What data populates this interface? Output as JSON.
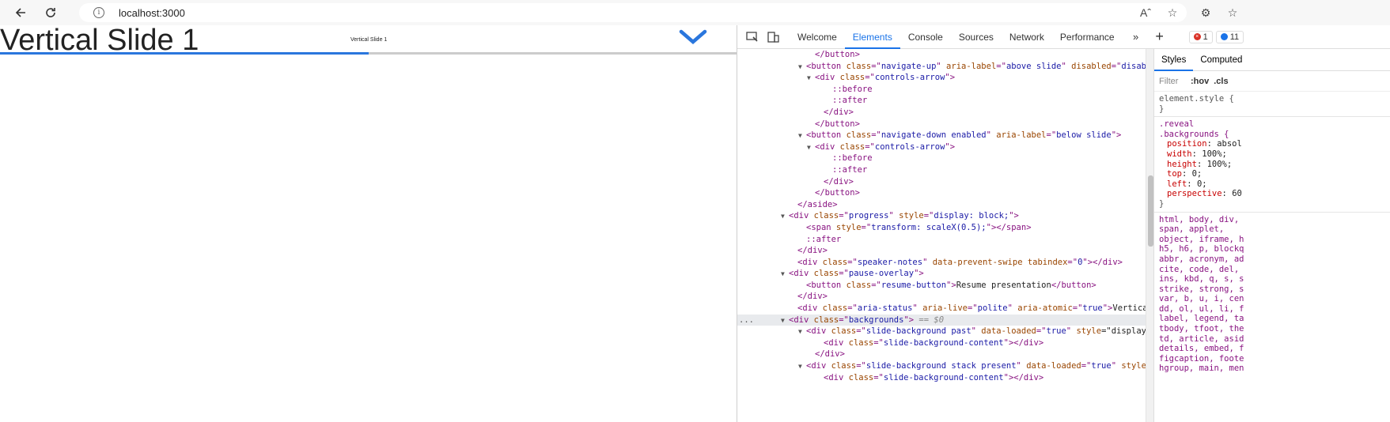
{
  "browser": {
    "url": "localhost:3000"
  },
  "page": {
    "slide_title": "Vertical Slide 1",
    "small_label": "Vertical Slide 1",
    "progress": 0.5
  },
  "devtools": {
    "tabs": [
      "Welcome",
      "Elements",
      "Console",
      "Sources",
      "Network",
      "Performance"
    ],
    "active_tab": "Elements",
    "error_count": "1",
    "message_count": "11",
    "styles_tabs": [
      "Styles",
      "Computed"
    ],
    "filter_placeholder": "Filter",
    "hov": ":hov",
    "cls": ".cls",
    "dom_lines": [
      {
        "indent": 8,
        "tri": "",
        "html": "</button>"
      },
      {
        "indent": 7,
        "tri": "▼",
        "html": "<button class=\"navigate-up\" aria-label=\"above slide\" disabled=\"disabled\">"
      },
      {
        "indent": 8,
        "tri": "▼",
        "html": "<div class=\"controls-arrow\">"
      },
      {
        "indent": 10,
        "tri": "",
        "html": "::before"
      },
      {
        "indent": 10,
        "tri": "",
        "html": "::after"
      },
      {
        "indent": 9,
        "tri": "",
        "html": "</div>"
      },
      {
        "indent": 8,
        "tri": "",
        "html": "</button>"
      },
      {
        "indent": 7,
        "tri": "▼",
        "html": "<button class=\"navigate-down enabled\" aria-label=\"below slide\">"
      },
      {
        "indent": 8,
        "tri": "▼",
        "html": "<div class=\"controls-arrow\">"
      },
      {
        "indent": 10,
        "tri": "",
        "html": "::before"
      },
      {
        "indent": 10,
        "tri": "",
        "html": "::after"
      },
      {
        "indent": 9,
        "tri": "",
        "html": "</div>"
      },
      {
        "indent": 8,
        "tri": "",
        "html": "</button>"
      },
      {
        "indent": 6,
        "tri": "",
        "html": "</aside>"
      },
      {
        "indent": 5,
        "tri": "▼",
        "html": "<div class=\"progress\" style=\"display: block;\">"
      },
      {
        "indent": 7,
        "tri": "",
        "html": "<span style=\"transform: scaleX(0.5);\"></span>"
      },
      {
        "indent": 7,
        "tri": "",
        "html": "::after"
      },
      {
        "indent": 6,
        "tri": "",
        "html": "</div>"
      },
      {
        "indent": 6,
        "tri": "",
        "html": "<div class=\"speaker-notes\" data-prevent-swipe tabindex=\"0\"></div>"
      },
      {
        "indent": 5,
        "tri": "▼",
        "html": "<div class=\"pause-overlay\">"
      },
      {
        "indent": 7,
        "tri": "",
        "html": "<button class=\"resume-button\">Resume presentation</button>"
      },
      {
        "indent": 6,
        "tri": "",
        "html": "</div>"
      },
      {
        "indent": 6,
        "tri": "",
        "html": "<div class=\"aria-status\" aria-live=\"polite\" aria-atomic=\"true\">Vertical Slid"
      },
      {
        "indent": 5,
        "tri": "▼",
        "html": "<div class=\"backgrounds\"> == $0",
        "selected": true
      },
      {
        "indent": 7,
        "tri": "▼",
        "html": "<div class=\"slide-background past\" data-loaded=\"true\" style=\"display: blo"
      },
      {
        "indent": 9,
        "tri": "",
        "html": "<div class=\"slide-background-content\"></div>"
      },
      {
        "indent": 8,
        "tri": "",
        "html": "</div>"
      },
      {
        "indent": 7,
        "tri": "▼",
        "html": "<div class=\"slide-background stack present\" data-loaded=\"true\" style=\"dis"
      },
      {
        "indent": 9,
        "tri": "",
        "html": "<div class=\"slide-background-content\"></div>"
      }
    ],
    "css": {
      "element_style": "element.style {",
      "rule_selector_1": ".reveal",
      "rule_selector_2": ".backgrounds {",
      "props": [
        {
          "p": "position",
          "v": "absol"
        },
        {
          "p": "width",
          "v": "100%;"
        },
        {
          "p": "height",
          "v": "100%;"
        },
        {
          "p": "top",
          "v": "0;"
        },
        {
          "p": "left",
          "v": "0;"
        },
        {
          "p": "perspective",
          "v": "60"
        }
      ],
      "reset_lines": [
        "html, body, div,",
        "span, applet,",
        "object, iframe, h",
        "h5, h6, p, blockq",
        "abbr, acronym, ad",
        "cite, code, del,",
        "ins, kbd, q, s, s",
        "strike, strong, s",
        "var, b, u, i, cen",
        "dd, ol, ul, li, f",
        "label, legend, ta",
        "tbody, tfoot, the",
        "td, article, asid",
        "details, embed, f",
        "figcaption, foote",
        "hgroup, main, men"
      ]
    }
  }
}
